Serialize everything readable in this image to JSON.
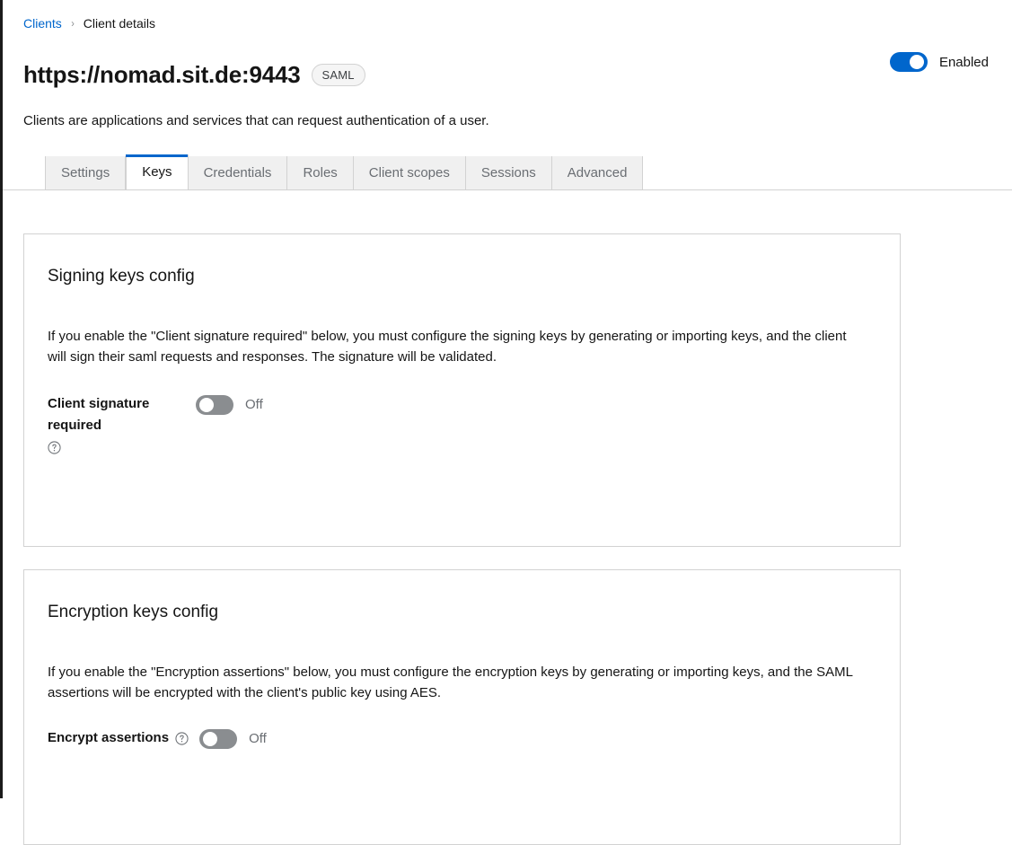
{
  "breadcrumb": {
    "parent": "Clients",
    "separator": "›",
    "current": "Client details"
  },
  "header": {
    "client_title": "https://nomad.sit.de:9443",
    "protocol_badge": "SAML",
    "subtitle": "Clients are applications and services that can request authentication of a user.",
    "enabled_label": "Enabled",
    "enabled_state": "on"
  },
  "tabs": [
    {
      "label": "Settings",
      "active": false
    },
    {
      "label": "Keys",
      "active": true
    },
    {
      "label": "Credentials",
      "active": false
    },
    {
      "label": "Roles",
      "active": false
    },
    {
      "label": "Client scopes",
      "active": false
    },
    {
      "label": "Sessions",
      "active": false
    },
    {
      "label": "Advanced",
      "active": false
    }
  ],
  "signing_card": {
    "title": "Signing keys config",
    "description": "If you enable the \"Client signature required\" below, you must configure the signing keys by generating or importing keys, and the client will sign their saml requests and responses. The signature will be validated.",
    "field_label": "Client signature required",
    "toggle_state": "Off"
  },
  "encryption_card": {
    "title": "Encryption keys config",
    "description": "If you enable the \"Encryption assertions\" below, you must configure the encryption keys by generating or importing keys, and the SAML assertions will be encrypted with the client's public key using AES.",
    "field_label": "Encrypt assertions",
    "toggle_state": "Off"
  },
  "colors": {
    "accent": "#0066cc",
    "toggle_off": "#8a8d90",
    "border": "#d2d2d2",
    "text": "#151515",
    "muted": "#6a6e73",
    "sidebar_edge": "#1b1b1b"
  },
  "icons": {
    "help": "help-circle-icon",
    "chevron": "chevron-right-icon"
  }
}
